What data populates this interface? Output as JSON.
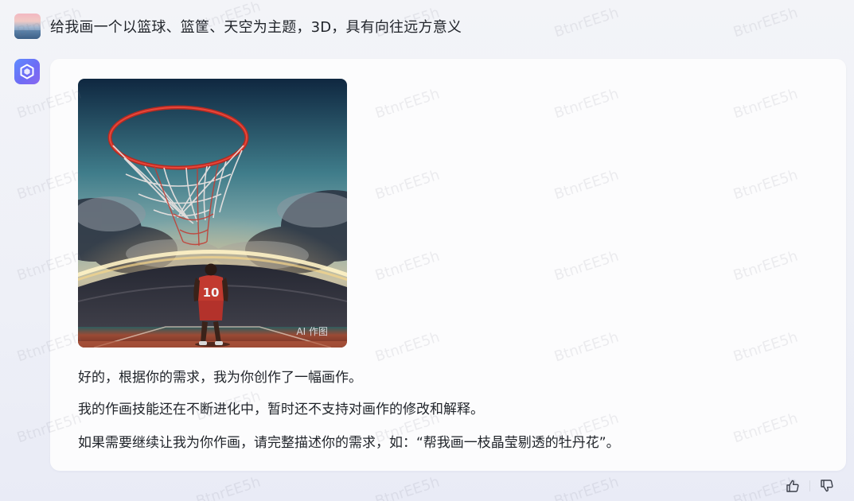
{
  "conversation": {
    "user_message": "给我画一个以篮球、篮筐、天空为主题，3D，具有向往远方意义",
    "assistant": {
      "image_tag": "AI 作图",
      "reply_lines": [
        "好的，根据你的需求，我为你创作了一幅画作。",
        "我的作画技能还在不断进化中，暂时还不支持对画作的修改和解释。",
        "如果需要继续让我为你作画，请完整描述你的需求，如：“帮我画一枝晶莹剔透的牡丹花”。"
      ]
    }
  },
  "image": {
    "player_number": "10"
  },
  "watermark": {
    "text": "BtnrEE5h"
  },
  "icons": {
    "user_avatar": "user-avatar-image",
    "bot_avatar": "assistant-logo-icon",
    "like": "thumbs-up-icon",
    "dislike": "thumbs-down-icon"
  },
  "colors": {
    "accent": "#6d6cf5",
    "card_bg": "#fcfcfd",
    "page_bg": "#eef0f7",
    "text": "#1f2329"
  }
}
